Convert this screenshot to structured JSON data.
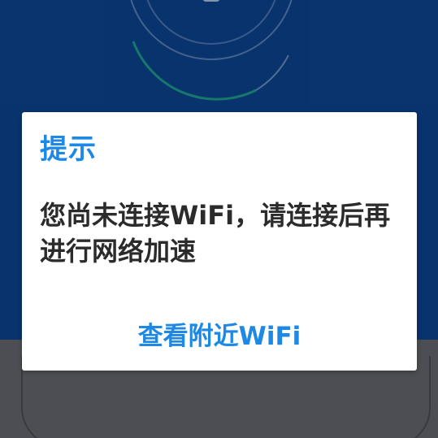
{
  "dialog": {
    "title": "提示",
    "message": "您尚未连接WiFi，请连接后再进行网络加速",
    "action_label": "查看附近WiFi"
  },
  "colors": {
    "background": "#0b3f86",
    "accent": "#1e88e5",
    "dialog_text": "#2b2b2b",
    "lower_background": "#5d6066"
  },
  "icons": {
    "gauge": "speed-gauge-icon"
  }
}
